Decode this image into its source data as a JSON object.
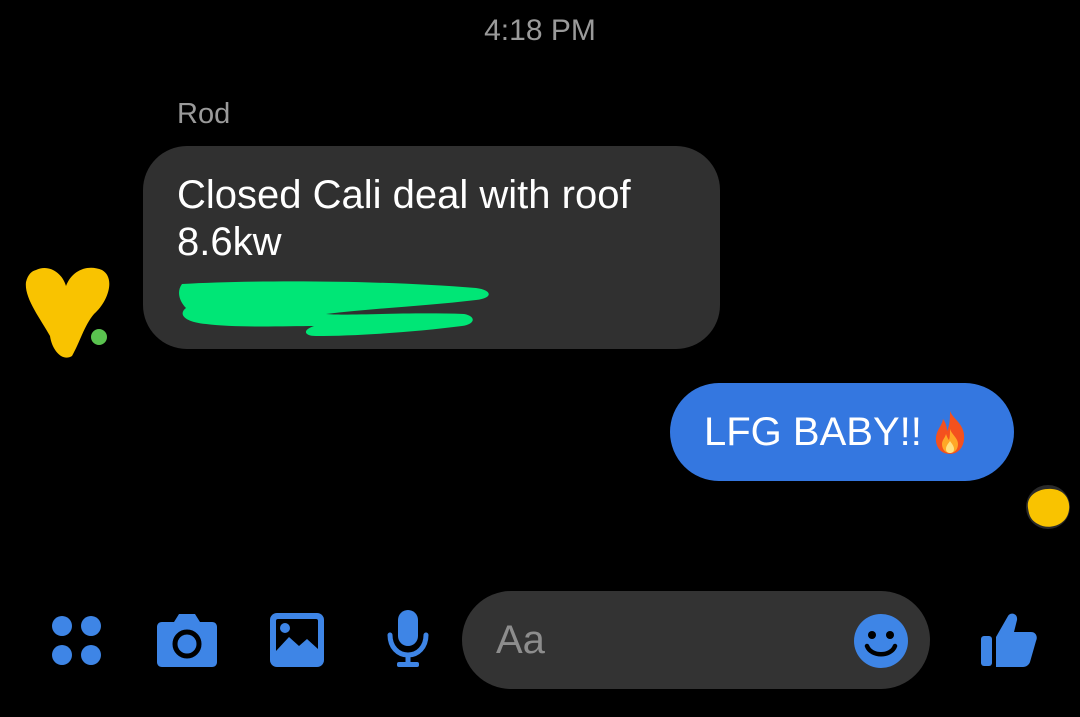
{
  "conversation": {
    "timestamp": "4:18 PM",
    "messages": [
      {
        "direction": "incoming",
        "sender": "Rod",
        "lines": [
          "Closed Cali deal with roof",
          "8.6kw"
        ]
      },
      {
        "direction": "outgoing",
        "text": "LFG BABY!!",
        "emoji_icon": "fire-icon"
      }
    ]
  },
  "composer": {
    "placeholder": "Aa",
    "icons": [
      "menu-dots-icon",
      "camera-icon",
      "gallery-icon",
      "microphone-icon",
      "emoji-icon",
      "thumbs-up-icon"
    ]
  },
  "colors": {
    "background": "#000000",
    "incoming_bubble": "#303030",
    "outgoing_bubble": "#3477e0",
    "accent_blue": "#3e85e6",
    "secondary_text": "#9a9a9a",
    "redaction_green": "#00e676",
    "scribble_yellow": "#f9c300"
  }
}
